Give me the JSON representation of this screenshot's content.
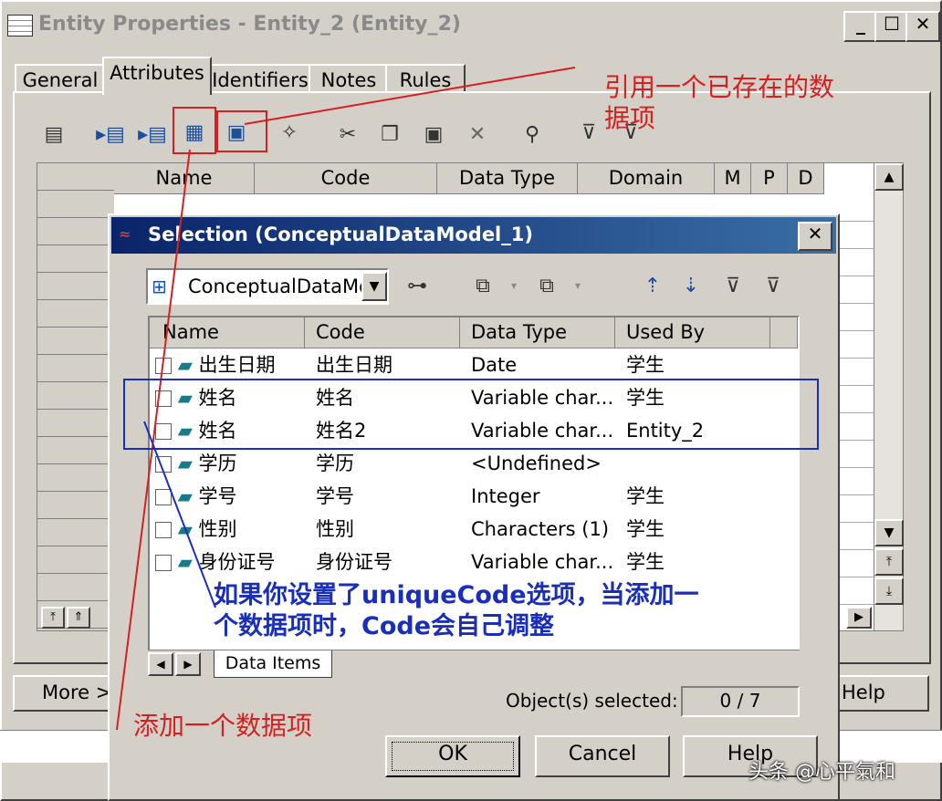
{
  "window": {
    "title": "Entity Properties - Entity_2 (Entity_2)",
    "minimize_label": "_",
    "maximize_label": "☐",
    "close_label": "✕"
  },
  "tabs": [
    "General",
    "Attributes",
    "Identifiers",
    "Notes",
    "Rules"
  ],
  "attr_grid": {
    "columns": [
      "Name",
      "Code",
      "Data Type",
      "Domain",
      "M",
      "P",
      "D"
    ]
  },
  "footer": {
    "more_label": "More >>",
    "help_label": "Help"
  },
  "dialog": {
    "title": "Selection (ConceptualDataModel_1)",
    "close_label": "✕",
    "model_select": "ConceptualDataMo",
    "columns": [
      "Name",
      "Code",
      "Data Type",
      "Used By"
    ],
    "rows": [
      {
        "name": "出生日期",
        "code": "出生日期",
        "type": "Date",
        "used": "学生"
      },
      {
        "name": "姓名",
        "code": "姓名",
        "type": "Variable char...",
        "used": "学生"
      },
      {
        "name": "姓名",
        "code": "姓名2",
        "type": "Variable char...",
        "used": "Entity_2"
      },
      {
        "name": "学历",
        "code": "学历",
        "type": "<Undefined>",
        "used": ""
      },
      {
        "name": "学号",
        "code": "学号",
        "type": "Integer",
        "used": "学生"
      },
      {
        "name": "性别",
        "code": "性别",
        "type": "Characters (1)",
        "used": "学生"
      },
      {
        "name": "身份证号",
        "code": "身份证号",
        "type": "Variable char...",
        "used": "学生"
      }
    ],
    "bottom_tab": "Data Items",
    "selected_label": "Object(s) selected:",
    "selected_value": "0 / 7",
    "ok_label": "OK",
    "cancel_label": "Cancel",
    "help_label": "Help"
  },
  "annotations": {
    "reuse_line1": "引用一个已存在的数",
    "reuse_line2": "据项",
    "unique_line1": "如果你设置了uniqueCode选项，当添加一",
    "unique_line2": "个数据项时，Code会自己调整",
    "add_item": "添加一个数据项"
  },
  "watermark": "头条 @心平氣和"
}
